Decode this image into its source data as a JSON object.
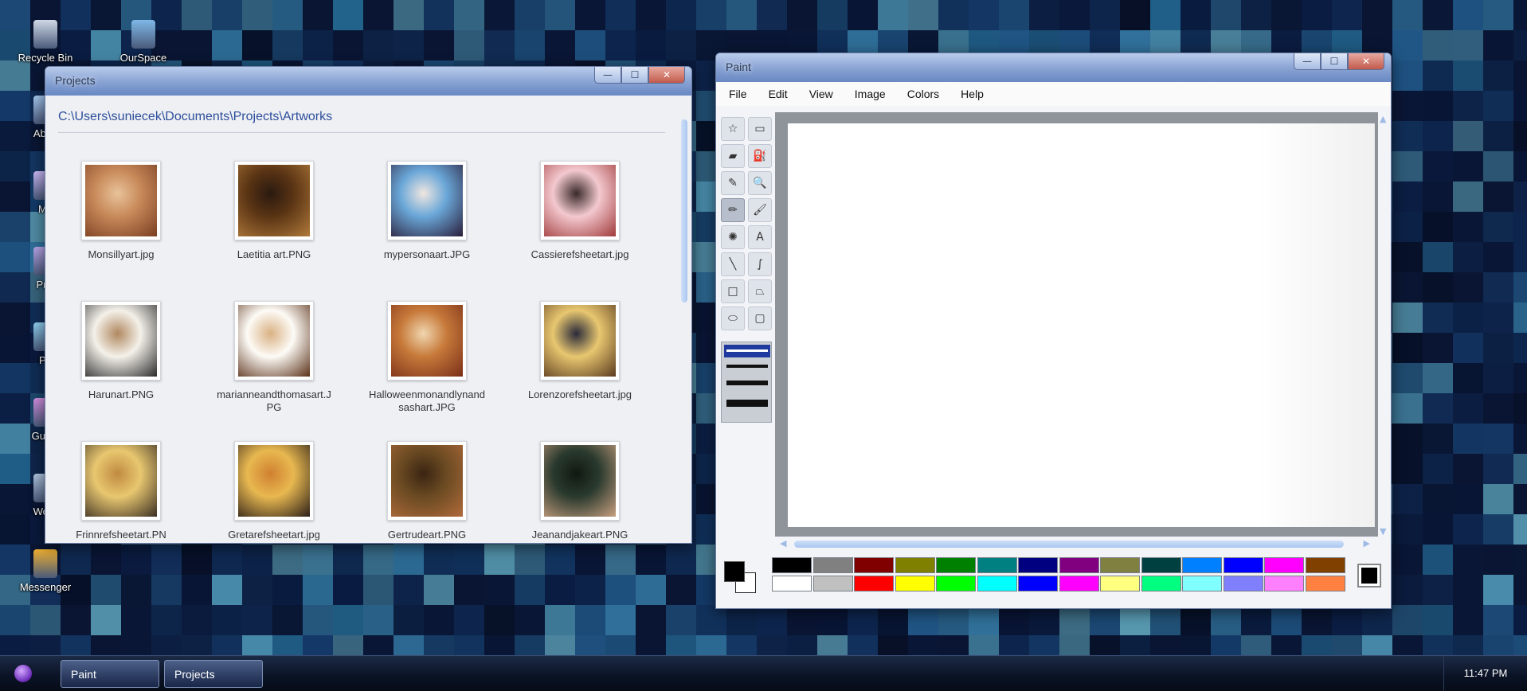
{
  "desktop": {
    "icons": [
      {
        "label": "Recycle Bin",
        "icon": "recycle-bin-icon"
      },
      {
        "label": "OurSpace",
        "icon": "ourspace-icon"
      },
      {
        "label": "Abou",
        "icon": "about-icon"
      },
      {
        "label": "Mu",
        "icon": "music-icon"
      },
      {
        "label": "Proj",
        "icon": "projects-icon"
      },
      {
        "label": "Pa",
        "icon": "paint-icon"
      },
      {
        "label": "Guest",
        "icon": "guestbook-icon"
      },
      {
        "label": "Word",
        "icon": "word-icon"
      },
      {
        "label": "Messenger",
        "icon": "messenger-icon"
      }
    ]
  },
  "projects_window": {
    "title": "Projects",
    "path": "C:\\Users\\suniecek\\Documents\\Projects\\Artworks",
    "buttons": {
      "minimize": "—",
      "maximize": "☐",
      "close": "✕"
    },
    "files": [
      {
        "name": "Monsillyart.jpg",
        "colors": [
          "#c88a5a",
          "#7a3e22",
          "#e8c39a"
        ]
      },
      {
        "name": "Laetitia art.PNG",
        "colors": [
          "#5a3414",
          "#b07a3a",
          "#2a1a10"
        ]
      },
      {
        "name": "mypersonaart.JPG",
        "colors": [
          "#6aa7d8",
          "#2a1e3a",
          "#f0e6e0"
        ]
      },
      {
        "name": "Cassierefsheetart.jpg",
        "colors": [
          "#f3c9cf",
          "#a03a3a",
          "#3a2a2a"
        ]
      },
      {
        "name": "Harunart.PNG",
        "colors": [
          "#f4f1ea",
          "#2a2a2a",
          "#b08860"
        ]
      },
      {
        "name": "marianneandthomasart.JPG",
        "colors": [
          "#fdfbf6",
          "#5a3018",
          "#d9b183"
        ]
      },
      {
        "name": "Halloweenmonandlynandsashart.JPG",
        "colors": [
          "#c77a3a",
          "#7a2e18",
          "#f0d6b0"
        ]
      },
      {
        "name": "Lorenzorefsheetart.jpg",
        "colors": [
          "#e8c770",
          "#5a3a1e",
          "#2a2a3a"
        ]
      },
      {
        "name": "Frinnrefsheetart.PN",
        "colors": [
          "#e8c770",
          "#3a2e22",
          "#c08a40"
        ]
      },
      {
        "name": "Gretarefsheetart.jpg",
        "colors": [
          "#e8b850",
          "#2a1e18",
          "#d08030"
        ]
      },
      {
        "name": "Gertrudeart.PNG",
        "colors": [
          "#6a4a22",
          "#b06a3a",
          "#3a2412"
        ]
      },
      {
        "name": "Jeanandjakeart.PNG",
        "colors": [
          "#2a3a2e",
          "#c8a080",
          "#111811"
        ]
      }
    ]
  },
  "paint_window": {
    "title": "Paint",
    "buttons": {
      "minimize": "—",
      "maximize": "☐",
      "close": "✕"
    },
    "menu": [
      "File",
      "Edit",
      "View",
      "Image",
      "Colors",
      "Help"
    ],
    "tools": [
      {
        "name": "free-select-tool",
        "glyph": "☆"
      },
      {
        "name": "rect-select-tool",
        "glyph": "▭"
      },
      {
        "name": "eraser-tool",
        "glyph": "▰"
      },
      {
        "name": "fill-tool",
        "glyph": "⛽"
      },
      {
        "name": "color-picker-tool",
        "glyph": "✎"
      },
      {
        "name": "magnifier-tool",
        "glyph": "🔍"
      },
      {
        "name": "pencil-tool",
        "glyph": "✏"
      },
      {
        "name": "brush-tool",
        "glyph": "🖌"
      },
      {
        "name": "airbrush-tool",
        "glyph": "✺"
      },
      {
        "name": "text-tool",
        "glyph": "A"
      },
      {
        "name": "line-tool",
        "glyph": "╲"
      },
      {
        "name": "curve-tool",
        "glyph": "∫"
      },
      {
        "name": "rectangle-tool",
        "glyph": "□"
      },
      {
        "name": "polygon-tool",
        "glyph": "⏢"
      },
      {
        "name": "ellipse-tool",
        "glyph": "⬭"
      },
      {
        "name": "rounded-rect-tool",
        "glyph": "▢"
      }
    ],
    "selected_tool_index": 6,
    "foreground": "#000000",
    "background": "#ffffff",
    "palette_top": [
      "#000000",
      "#808080",
      "#800000",
      "#808000",
      "#008000",
      "#008080",
      "#000080",
      "#800080",
      "#808040",
      "#004040",
      "#0080ff",
      "#0000ff",
      "#ff00ff",
      "#804000"
    ],
    "palette_bottom": [
      "#ffffff",
      "#c0c0c0",
      "#ff0000",
      "#ffff00",
      "#00ff00",
      "#00ffff",
      "#0000ff",
      "#ff00ff",
      "#ffff80",
      "#00ff80",
      "#80ffff",
      "#8080ff",
      "#ff80ff",
      "#ff8040"
    ]
  },
  "taskbar": {
    "buttons": [
      "Paint",
      "Projects"
    ],
    "clock": "11:47 PM"
  }
}
